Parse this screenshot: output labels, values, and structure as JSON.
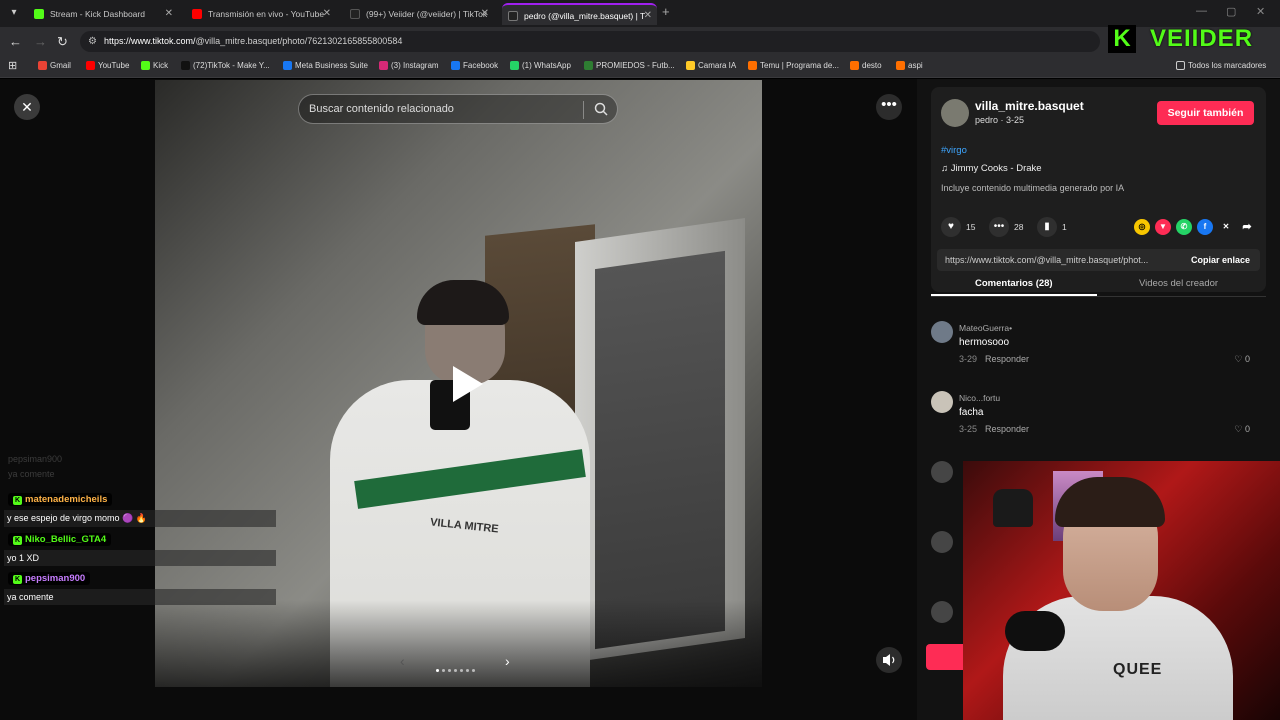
{
  "browser": {
    "tabs": [
      {
        "title": "Stream - Kick Dashboard",
        "color": "#53fc18",
        "active": false
      },
      {
        "title": "Transmisión en vivo - YouTube",
        "color": "#ff0000",
        "active": false
      },
      {
        "title": "(99+) Veiider (@veiider) | TikTok",
        "color": "#222222",
        "active": false
      },
      {
        "title": "pedro (@villa_mitre.basquet) | T",
        "color": "#222222",
        "active": true
      }
    ],
    "url_prefix": "https://www.tiktok.com/",
    "url_rest": "@villa_mitre.basquet/photo/7621302165855800584",
    "bookmarks": [
      {
        "label": "Gmail",
        "color": "#ea4335"
      },
      {
        "label": "YouTube",
        "color": "#ff0000"
      },
      {
        "label": "Kick",
        "color": "#53fc18"
      },
      {
        "label": "(72)TikTok - Make Y...",
        "color": "#111111"
      },
      {
        "label": "Meta Business Suite",
        "color": "#1877f2"
      },
      {
        "label": "(3) Instagram",
        "color": "#d62976"
      },
      {
        "label": "Facebook",
        "color": "#1877f2"
      },
      {
        "label": "(1) WhatsApp",
        "color": "#25d366"
      },
      {
        "label": "PROMIEDOS - Futb...",
        "color": "#2e7d32"
      },
      {
        "label": "Camara IA",
        "color": "#ffca28"
      },
      {
        "label": "Temu | Programa de...",
        "color": "#ff6f00"
      },
      {
        "label": "desto",
        "color": "#ff6f00"
      },
      {
        "label": "aspi",
        "color": "#ff6f00"
      }
    ],
    "all_bookmarks": "Todos los marcadores"
  },
  "overlay": {
    "kick_logo_letter": "K",
    "streamer_name": "VEIIDER"
  },
  "viewer": {
    "search_placeholder": "Buscar contenido relacionado",
    "jacket_text": "VILLA MITRE"
  },
  "chat": {
    "ghost_user": "pepsiman900",
    "ghost_text": "ya comente",
    "messages": [
      {
        "user": "matenademicheils",
        "color": "#ffb347",
        "text": "y ese espejo de virgo momo 🟣 🔥"
      },
      {
        "user": "Niko_Bellic_GTA4",
        "color": "#53fc18",
        "text": "yo 1 XD"
      },
      {
        "user": "pepsiman900",
        "color": "#c77dff",
        "text": "ya comente"
      }
    ]
  },
  "post": {
    "handle": "villa_mitre.basquet",
    "sub": "pedro · 3-25",
    "follow_label": "Seguir también",
    "hashtag": "#virgo",
    "music": "♫  Jimmy Cooks - Drake",
    "ai_note": "Incluye contenido multimedia generado por IA",
    "likes": "15",
    "comments": "28",
    "saves": "1",
    "link": "https://www.tiktok.com/@villa_mitre.basquet/phot...",
    "copy_label": "Copiar enlace",
    "tab_comments": "Comentarios (28)",
    "tab_videos": "Videos del creador"
  },
  "comments": [
    {
      "user": "MateoGuerra•",
      "text": "hermosooo",
      "date": "3-29",
      "reply": "Responder",
      "likes": "0"
    },
    {
      "user": "Nico...fortu",
      "text": "facha",
      "date": "3-25",
      "reply": "Responder",
      "likes": "0"
    }
  ],
  "webcam": {
    "shirt_text": "QUEE"
  }
}
